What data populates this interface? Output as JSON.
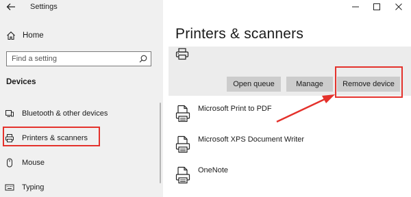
{
  "window": {
    "title": "Settings",
    "controls": [
      "minimize",
      "maximize",
      "close"
    ]
  },
  "sidebar": {
    "home_label": "Home",
    "search_placeholder": "Find a setting",
    "section_title": "Devices",
    "items": [
      {
        "label": "Bluetooth & other devices",
        "icon": "bluetooth-devices-icon"
      },
      {
        "label": "Printers & scanners",
        "icon": "printer-icon",
        "selected": true
      },
      {
        "label": "Mouse",
        "icon": "mouse-icon"
      },
      {
        "label": "Typing",
        "icon": "keyboard-icon"
      }
    ]
  },
  "main": {
    "title": "Printers & scanners",
    "selected_actions": {
      "open_queue": "Open queue",
      "manage": "Manage",
      "remove_device": "Remove device"
    },
    "devices": [
      {
        "label": "Microsoft Print to PDF",
        "icon": "printer-document-icon"
      },
      {
        "label": "Microsoft XPS Document Writer",
        "icon": "printer-document-icon"
      },
      {
        "label": "OneNote",
        "icon": "printer-document-icon"
      }
    ]
  },
  "annotations": {
    "highlight_color": "#e4312b"
  }
}
